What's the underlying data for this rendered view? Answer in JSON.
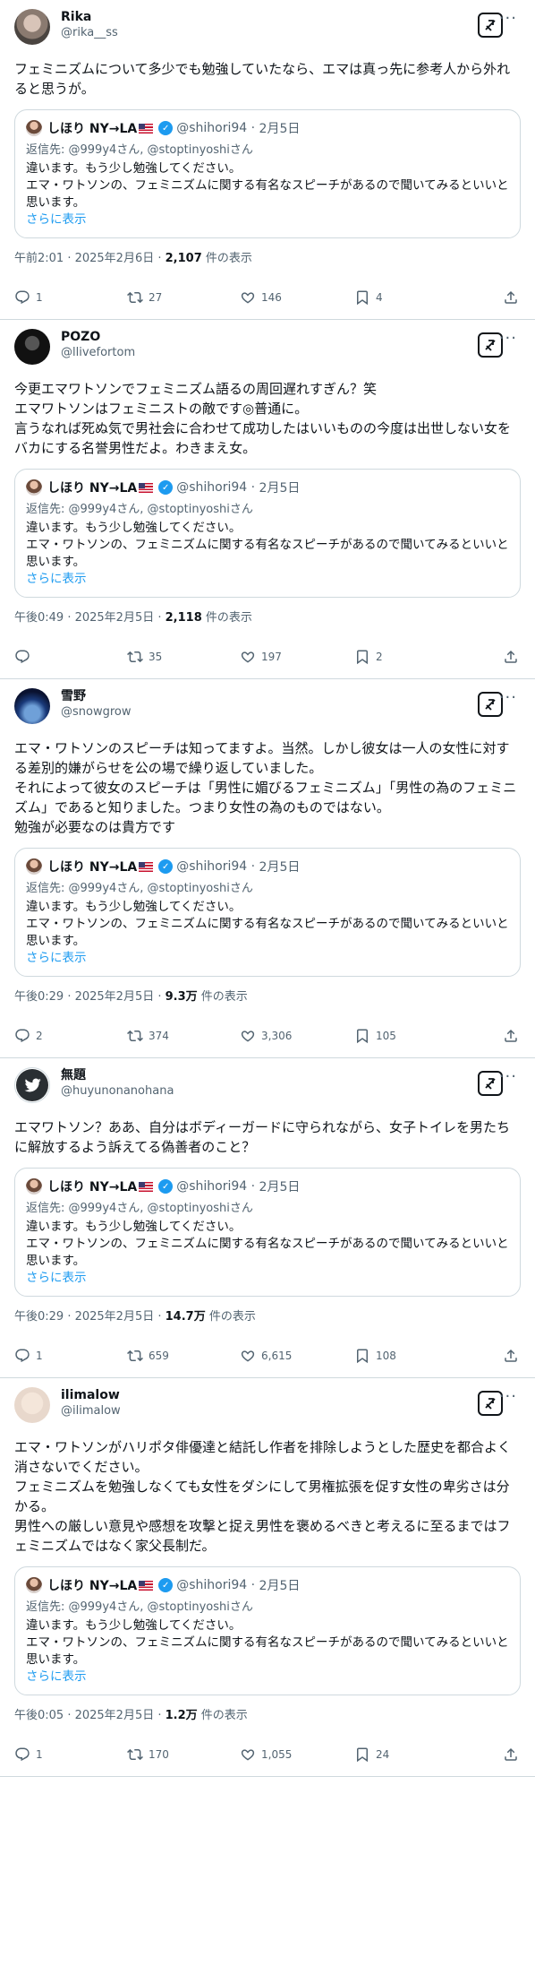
{
  "ui": {
    "show_more": "さらに表示",
    "views_suffix": "件の表示",
    "more_dots": "···"
  },
  "quoted": {
    "name": "しほり NY→LA",
    "handle": "@shihori94",
    "date": "2月5日",
    "reply_to": "返信先: @999y4さん, @stoptinyoshiさん",
    "text": "違います。もう少し勉強してください。\nエマ・ワトソンの、フェミニズムに関する有名なスピーチがあるので聞いてみるといいと思います。"
  },
  "tweets": [
    {
      "name": "Rika",
      "handle": "@rika__ss",
      "text": "フェミニズムについて多少でも勉強していたなら、エマは真っ先に参考人から外れると思うが。",
      "time": "午前2:01 · 2025年2月6日 · ",
      "views": "2,107",
      "replies": "1",
      "retweets": "27",
      "likes": "146",
      "bookmarks": "4"
    },
    {
      "name": "POZO",
      "handle": "@llivefortom",
      "text": "今更エマワトソンでフェミニズム語るの周回遅れすぎん？笑\nエマワトソンはフェミニストの敵です◎普通に。\n言うなれば死ぬ気で男社会に合わせて成功したはいいものの今度は出世しない女をバカにする名誉男性だよ。わきまえ女。",
      "time": "午後0:49 · 2025年2月5日 · ",
      "views": "2,118",
      "replies": "",
      "retweets": "35",
      "likes": "197",
      "bookmarks": "2"
    },
    {
      "name": "雪野",
      "handle": "@snowgrow",
      "text": "エマ・ワトソンのスピーチは知ってますよ。当然。しかし彼女は一人の女性に対する差別的嫌がらせを公の場で繰り返していました。\nそれによって彼女のスピーチは「男性に媚びるフェミニズム」「男性の為のフェミニズム」であると知りました。つまり女性の為のものではない。\n勉強が必要なのは貴方です",
      "time": "午後0:29 · 2025年2月5日 · ",
      "views": "9.3万",
      "replies": "2",
      "retweets": "374",
      "likes": "3,306",
      "bookmarks": "105"
    },
    {
      "name": "無題",
      "handle": "@huyunonanohana",
      "text": "エマワトソン？ああ、自分はボディーガードに守られながら、女子トイレを男たちに解放するよう訴えてる偽善者のこと？",
      "time": "午後0:29 · 2025年2月5日 · ",
      "views": "14.7万",
      "replies": "1",
      "retweets": "659",
      "likes": "6,615",
      "bookmarks": "108"
    },
    {
      "name": "ilimalow",
      "handle": "@ilimalow",
      "text": "エマ・ワトソンがハリポタ俳優達と結託し作者を排除しようとした歴史を都合よく消さないでください。\nフェミニズムを勉強しなくても女性をダシにして男権拡張を促す女性の卑劣さは分かる。\n男性への厳しい意見や感想を攻撃と捉え男性を褒めるべきと考えるに至るまではフェミニズムではなく家父長制だ。",
      "time": "午後0:05 · 2025年2月5日 · ",
      "views": "1.2万",
      "replies": "1",
      "retweets": "170",
      "likes": "1,055",
      "bookmarks": "24"
    }
  ],
  "colors": {
    "accent": "#1d9bf0",
    "secondary": "#536471",
    "border": "#cfd9de"
  }
}
